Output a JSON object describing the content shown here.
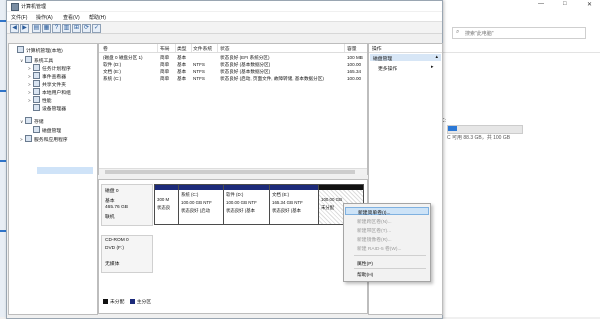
{
  "window": {
    "title": "计算机管理",
    "menu": [
      "文件(F)",
      "操作(A)",
      "查看(V)",
      "帮助(H)"
    ]
  },
  "tree": {
    "items": [
      {
        "label": "计算机管理(本地)",
        "level": 0,
        "expander": ""
      },
      {
        "label": "系统工具",
        "level": 1,
        "expander": "∨"
      },
      {
        "label": "任务计划程序",
        "level": 2,
        "expander": ">"
      },
      {
        "label": "事件查看器",
        "level": 2,
        "expander": ">"
      },
      {
        "label": "共享文件夹",
        "level": 2,
        "expander": ">"
      },
      {
        "label": "本地用户和组",
        "level": 2,
        "expander": ">"
      },
      {
        "label": "性能",
        "level": 2,
        "expander": ">"
      },
      {
        "label": "设备管理器",
        "level": 2,
        "expander": ""
      },
      {
        "label": "存储",
        "level": 1,
        "expander": "∨"
      },
      {
        "label": "磁盘管理",
        "level": 2,
        "expander": ""
      },
      {
        "label": "服务和应用程序",
        "level": 1,
        "expander": ">"
      }
    ]
  },
  "volumes": {
    "columns": [
      "卷",
      "布局",
      "类型",
      "文件系统",
      "状态",
      "容量"
    ],
    "rows": [
      [
        "(磁盘 0 磁盘分区 1)",
        "简单",
        "基本",
        "",
        "状态良好 (EFI 系统分区)",
        "100 MB"
      ],
      [
        "软件 (D:)",
        "简单",
        "基本",
        "NTFS",
        "状态良好 (基本数据分区)",
        "100.00"
      ],
      [
        "文档 (E:)",
        "简单",
        "基本",
        "NTFS",
        "状态良好 (基本数据分区)",
        "165.34"
      ],
      [
        "系统 (C:)",
        "简单",
        "基本",
        "NTFS",
        "状态良好 (启动, 页面文件, 故障转储, 基本数据分区)",
        "100.00"
      ]
    ]
  },
  "disks": [
    {
      "name": "磁盘 0",
      "lines": [
        "基本",
        "465.76 GB",
        "联机"
      ],
      "partitions": [
        {
          "lines": [
            "300 M",
            "状态良"
          ]
        },
        {
          "lines": [
            "系统 (C:)",
            "100.00 GB NTF",
            "状态良好 (启动"
          ]
        },
        {
          "lines": [
            "软件 (D:)",
            "100.00 GB NTF",
            "状态良好 (基本"
          ]
        },
        {
          "lines": [
            "文档 (E:)",
            "165.34 GB NTF",
            "状态良好 (基本"
          ]
        },
        {
          "lines": [
            "100.00 GB",
            "未分配"
          ]
        }
      ]
    },
    {
      "name": "CD-ROM 0",
      "lines": [
        "DVD (F:)",
        "",
        "无媒体"
      ]
    }
  ],
  "legend": [
    {
      "label": "未分配",
      "color": "#111111"
    },
    {
      "label": "主分区",
      "color": "#1c2a7a"
    }
  ],
  "actions": {
    "title": "操作",
    "section": "磁盘管理",
    "more": "更多操作"
  },
  "context_menu": {
    "items": [
      {
        "label": "新建简单卷(I)...",
        "enabled": true
      },
      {
        "label": "新建跨区卷(N)...",
        "enabled": false
      },
      {
        "label": "新建带区卷(T)...",
        "enabled": false
      },
      {
        "label": "新建镜像卷(R)...",
        "enabled": false
      },
      {
        "label": "新建 RAID-5 卷(W)...",
        "enabled": false
      },
      {
        "label": "属性(P)",
        "enabled": true
      },
      {
        "label": "帮助(H)",
        "enabled": true
      }
    ]
  },
  "background": {
    "search_placeholder": "搜索\"此电脑\"",
    "drive_text": "C 可用 88.3 GB，共 100 GB",
    "drive_label": "C:",
    "drive_used_fraction": 0.12
  }
}
